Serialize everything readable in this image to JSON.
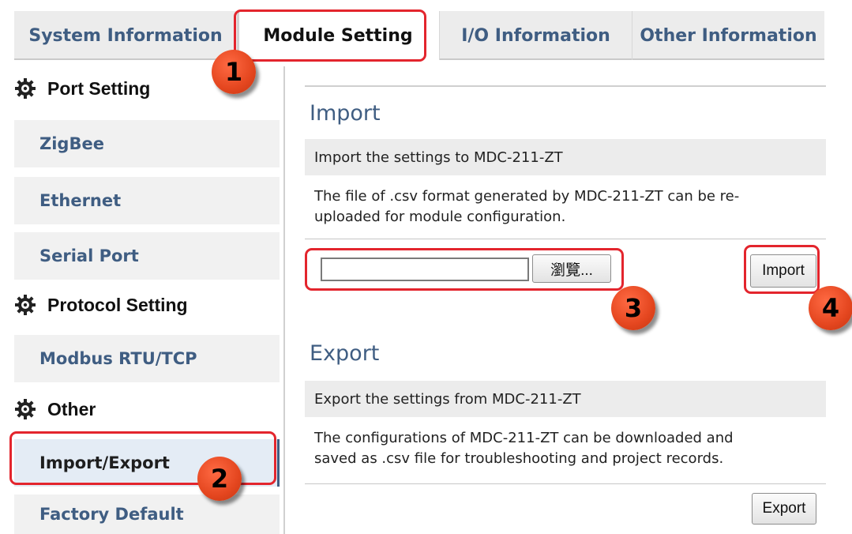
{
  "tabs": [
    {
      "label": "System Information"
    },
    {
      "label": "Module Setting"
    },
    {
      "label": "I/O Information"
    },
    {
      "label": "Other Information"
    }
  ],
  "sidebar": {
    "port_heading": "Port Setting",
    "protocol_heading": "Protocol Setting",
    "other_heading": "Other",
    "items": [
      {
        "label": "ZigBee"
      },
      {
        "label": "Ethernet"
      },
      {
        "label": "Serial Port"
      },
      {
        "label": "Modbus RTU/TCP"
      },
      {
        "label": "Import/Export"
      },
      {
        "label": "Factory Default"
      }
    ]
  },
  "import": {
    "title": "Import",
    "bar": "Import the settings to MDC-211-ZT",
    "desc_line1": "The file of .csv format generated by MDC-211-ZT can be re-",
    "desc_line2": "uploaded for module configuration.",
    "file_value": "",
    "browse_label": "瀏覽...",
    "button_label": "Import"
  },
  "export": {
    "title": "Export",
    "bar": "Export the settings from MDC-211-ZT",
    "desc_line1": "The configurations of MDC-211-ZT can be downloaded and",
    "desc_line2": "saved as .csv file for troubleshooting and project records.",
    "button_label": "Export"
  },
  "markers": [
    "1",
    "2",
    "3",
    "4"
  ],
  "colors": {
    "accent_text": "#3f5d82",
    "highlight": "#e3252d",
    "marker": "#e4461f"
  }
}
